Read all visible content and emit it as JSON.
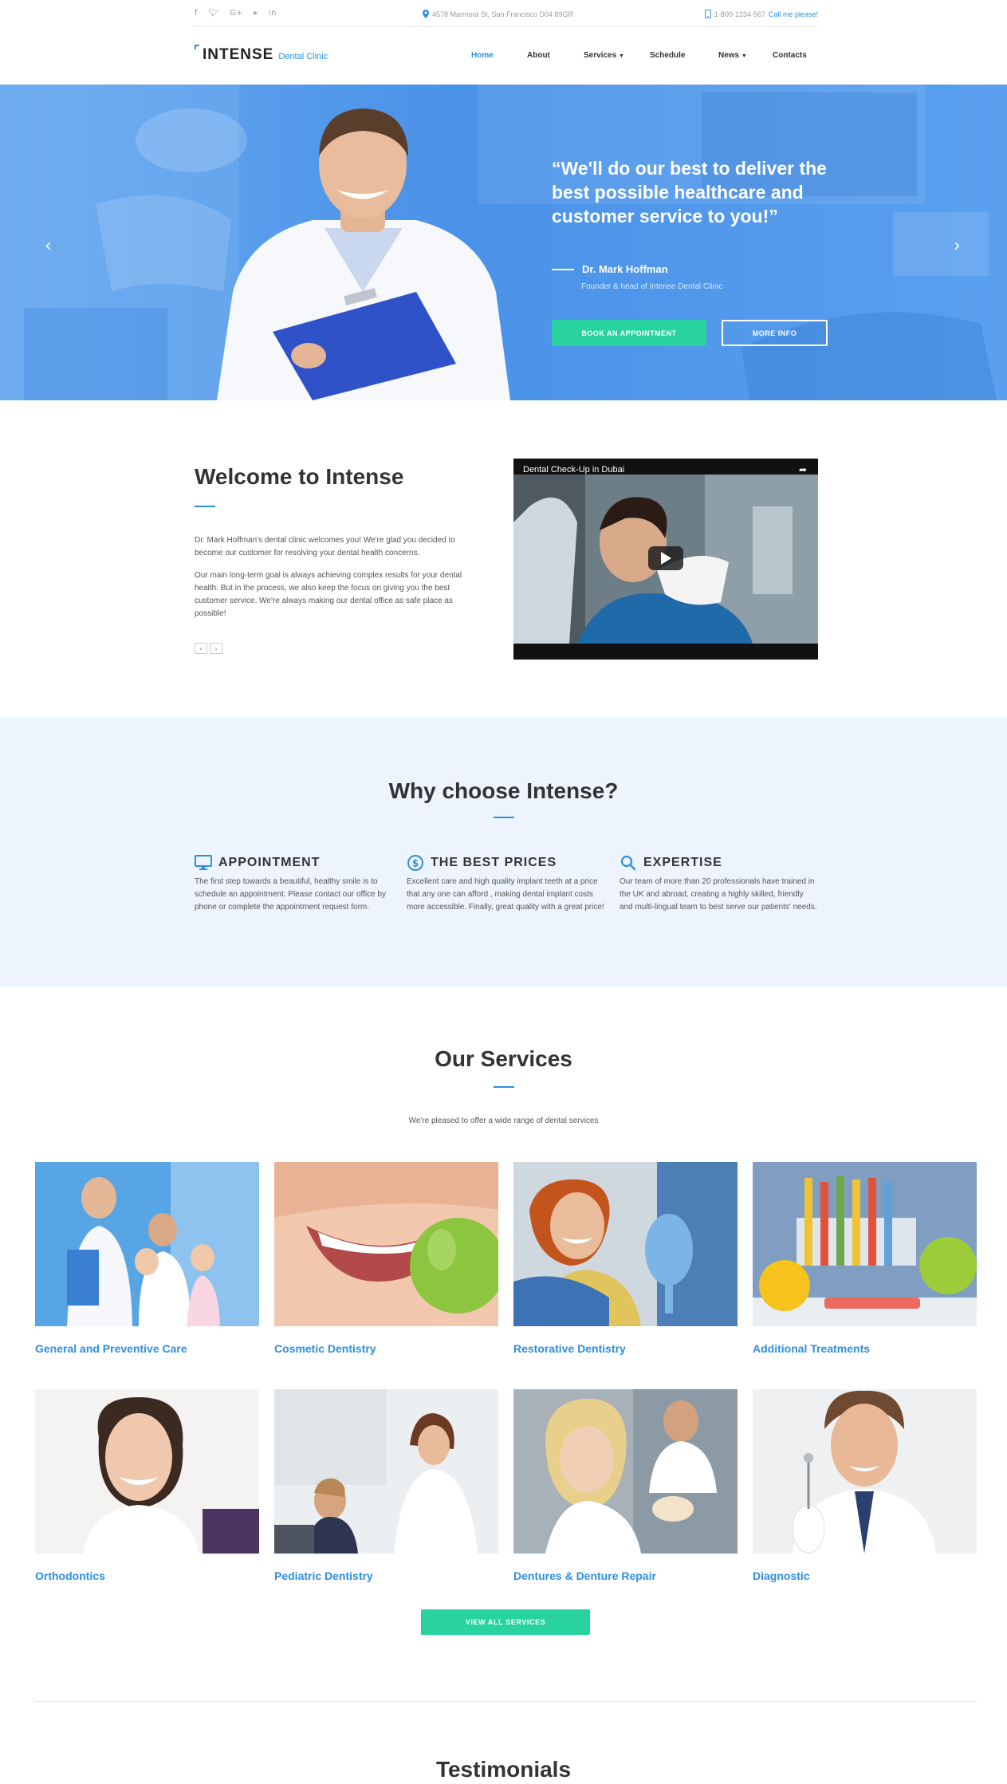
{
  "topbar": {
    "social": [
      {
        "icon": "facebook-icon",
        "glyph": "f"
      },
      {
        "icon": "twitter-icon",
        "glyph": "ᵛ"
      },
      {
        "icon": "google-plus-icon",
        "glyph": "G+"
      },
      {
        "icon": "youtube-icon",
        "glyph": "▸"
      },
      {
        "icon": "linkedin-icon",
        "glyph": "in"
      }
    ],
    "address": "4578 Marmora St, San Francisco D04 89GR",
    "phone": "1-800-1234-567",
    "call_link": "Call me please!"
  },
  "header": {
    "brand": "INTENSE",
    "brand_sub": "Dental Clinic",
    "nav": [
      "Home",
      "About",
      "Services",
      "Schedule",
      "News",
      "Contacts"
    ],
    "active": "Home"
  },
  "hero": {
    "quote": "“We'll do our best to deliver the best possible healthcare and customer service to you!”",
    "author": "Dr. Mark Hoffman",
    "role": "Founder & head of Intense Dental Clinic",
    "primary_button": "BOOK AN APPOINTMENT",
    "secondary_button": "MORE INFO",
    "prev_glyph": "‹",
    "next_glyph": "›"
  },
  "welcome": {
    "title": "Welcome to Intense",
    "p1": "Dr. Mark Hoffman's dental clinic welcomes you! We're glad you decided to become our customer for resolving your dental health concerns.",
    "p2": "Our main long-term goal is always achieving complex results for your dental health. But in the process, we also keep the focus on giving you the best customer service. We're always making our dental office as safe place as possible!",
    "pager_prev": "‹",
    "pager_next": "›",
    "video_title": "Dental Check-Up in Dubai",
    "share_glyph": "➦"
  },
  "why": {
    "title": "Why choose Intense?",
    "features": [
      {
        "icon": "monitor-icon",
        "title": "APPOINTMENT",
        "text": "The first step towards a beautiful, healthy smile is to schedule an appointment. Please contact our office by phone or complete the appointment request form."
      },
      {
        "icon": "dollar-coin-icon",
        "title": "THE BEST PRICES",
        "text": "Excellent care and high quality implant teeth at a price that any one can afford , making dental implant costs more accessible. Finally, great quality with a great price!"
      },
      {
        "icon": "magnifier-icon",
        "title": "EXPERTISE",
        "text": "Our team of more than 20 professionals have trained in the UK and abroad, creating a highly skilled, friendly and multi-lingual team to best serve our patients' needs."
      }
    ]
  },
  "services": {
    "title": "Our Services",
    "subtitle": "We're pleased to offer a wide range of dental services",
    "items": [
      "General and Preventive Care",
      "Cosmetic Dentistry",
      "Restorative Dentistry",
      "Additional Treatments",
      "Orthodontics",
      "Pediatric Dentistry",
      "Dentures & Denture Repair",
      "Diagnostic"
    ],
    "button": "VIEW ALL SERVICES"
  },
  "testimonials": {
    "title": "Testimonials"
  },
  "colors": {
    "accent": "#2d8fe0",
    "cta": "#28d3a0",
    "hero": "#4a95ea",
    "band": "#edf4fd"
  }
}
